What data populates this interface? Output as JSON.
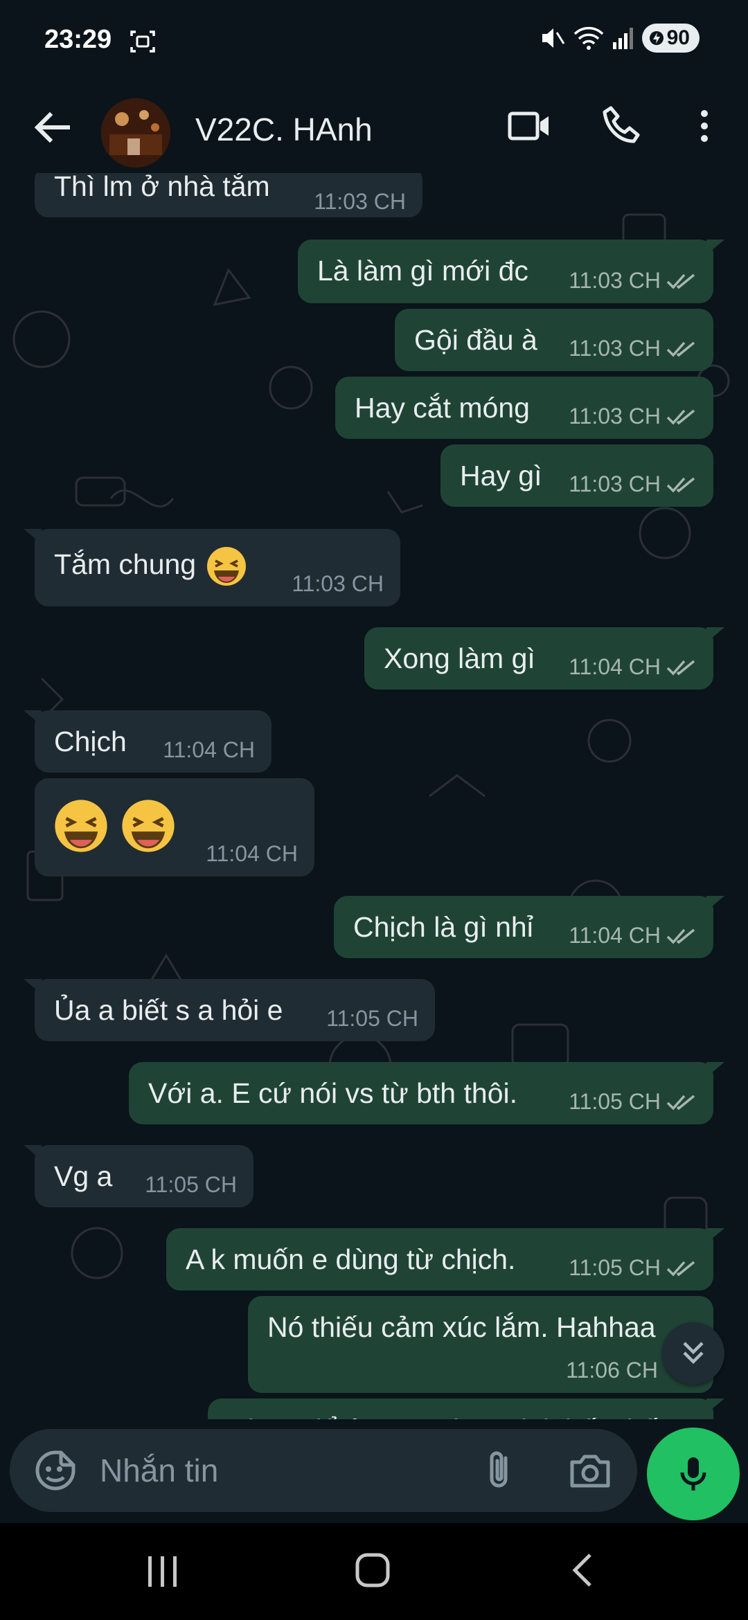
{
  "status": {
    "time": "23:29",
    "battery": "90"
  },
  "header": {
    "contact_name": "V22C. HAnh"
  },
  "messages": [
    {
      "dir": "in",
      "text": "Thì lm ở nhà tắm",
      "time": "11:03 CH"
    },
    {
      "dir": "out",
      "text": "Là làm gì mới đc",
      "time": "11:03 CH"
    },
    {
      "dir": "out",
      "text": "Gội đầu à",
      "time": "11:03 CH"
    },
    {
      "dir": "out",
      "text": "Hay cắt móng",
      "time": "11:03 CH"
    },
    {
      "dir": "out",
      "text": "Hay gì",
      "time": "11:03 CH"
    },
    {
      "dir": "in",
      "text": "Tắm chung",
      "emoji": "laughing-face",
      "time": "11:03 CH"
    },
    {
      "dir": "out",
      "text": "Xong làm gì",
      "time": "11:04 CH"
    },
    {
      "dir": "in",
      "text": "Chịch",
      "time": "11:04 CH"
    },
    {
      "dir": "in",
      "text": "",
      "emoji": "laughing-face x2",
      "time": "11:04 CH"
    },
    {
      "dir": "out",
      "text": "Chịch là gì nhỉ",
      "time": "11:04 CH"
    },
    {
      "dir": "in",
      "text": "Ủa a biết s a hỏi e",
      "time": "11:05 CH"
    },
    {
      "dir": "out",
      "text": "Với a. E cứ nói vs từ bth thôi.",
      "time": "11:05 CH"
    },
    {
      "dir": "in",
      "text": "Vg a",
      "time": "11:05 CH"
    },
    {
      "dir": "out",
      "text": "A k muốn e dùng từ chịch.",
      "time": "11:05 CH"
    },
    {
      "dir": "out",
      "text": "Nó thiếu cảm xúc lắm. Hahhaa",
      "time": "11:06 CH"
    },
    {
      "dir": "out",
      "text": "Chưa để ý xem tại sao lại thấy thế",
      "time": ""
    }
  ],
  "composer": {
    "placeholder": "Nhắn tin"
  },
  "colors": {
    "incoming": "#202c33",
    "outgoing": "#1f4435",
    "accent": "#21c063",
    "background": "#0b141a"
  },
  "icons": [
    "back-arrow-icon",
    "video-call-icon",
    "phone-icon",
    "more-vert-icon",
    "sticker-icon",
    "attach-icon",
    "camera-icon",
    "mic-icon",
    "double-check-icon",
    "scroll-down-icon"
  ]
}
